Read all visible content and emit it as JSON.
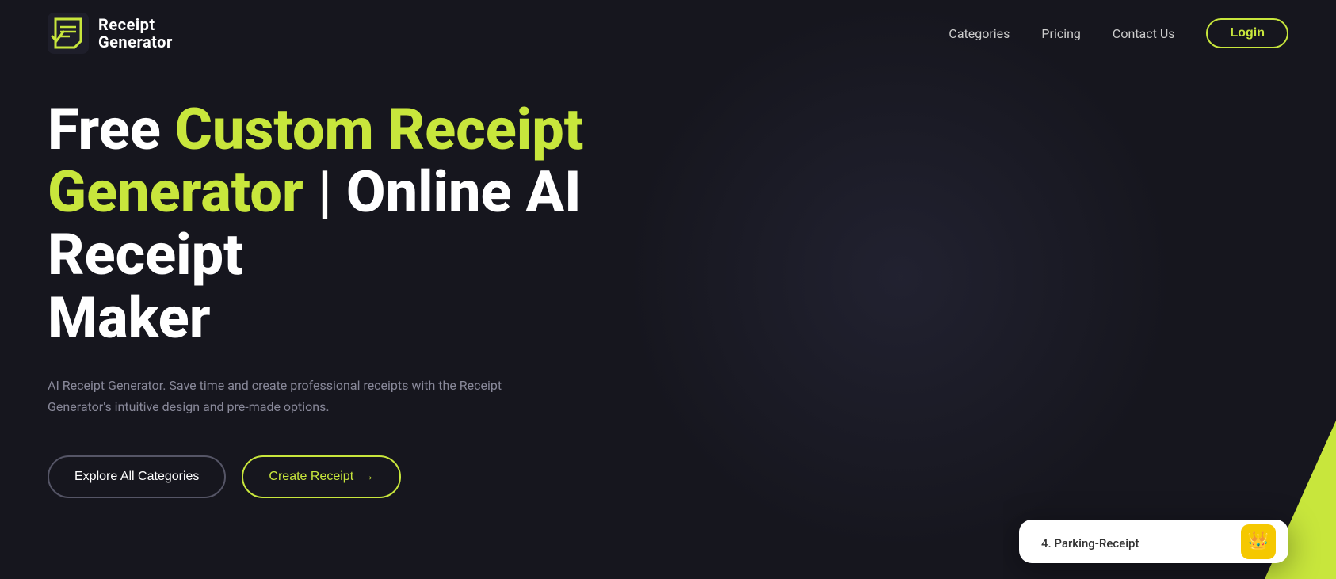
{
  "brand": {
    "name_line1": "Receipt",
    "name_line2": "Generator"
  },
  "nav": {
    "links": [
      {
        "label": "Categories",
        "name": "categories"
      },
      {
        "label": "Pricing",
        "name": "pricing"
      },
      {
        "label": "Contact Us",
        "name": "contact"
      }
    ],
    "login_label": "Login"
  },
  "hero": {
    "title_white1": "Free ",
    "title_accent1": "Custom Receipt",
    "title_newline": "",
    "title_accent2": "Generator",
    "title_white2": " | Online AI Receipt",
    "title_white3": "Maker",
    "subtitle": "AI Receipt Generator. Save time and create professional receipts with the Receipt Generator's intuitive design and pre-made options.",
    "btn_explore": "Explore All Categories",
    "btn_create": "Create Receipt",
    "btn_create_arrow": "→"
  },
  "card_preview": {
    "label": "4. Parking-Receipt",
    "icon": "👑"
  },
  "colors": {
    "accent": "#c8e63c",
    "background": "#16161e",
    "nav_link": "#cccccc",
    "subtitle": "#888899",
    "border_dark": "#555566"
  }
}
